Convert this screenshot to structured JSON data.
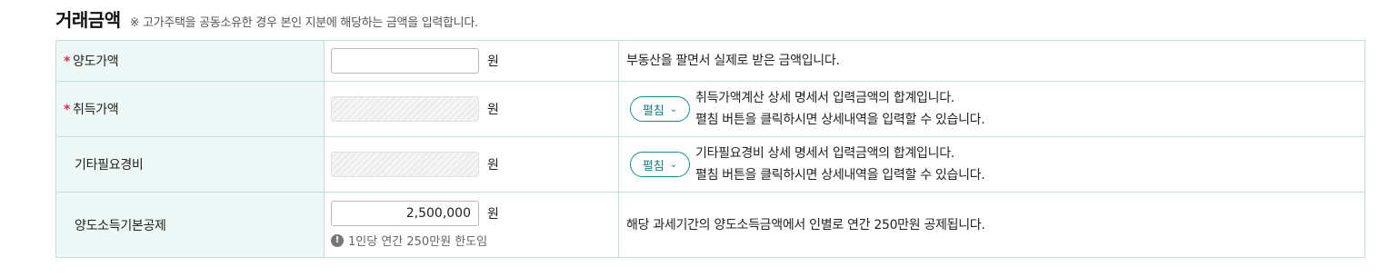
{
  "header": {
    "title": "거래금액",
    "note": "※ 고가주택을 공동소유한 경우 본인 지분에 해당하는 금액을 입력합니다."
  },
  "rows": [
    {
      "required_mark": "*",
      "label": "양도가액",
      "value": "",
      "unit": "원",
      "description": "부동산을 팔면서 실제로 받은 금액입니다."
    },
    {
      "required_mark": "*",
      "label": "취득가액",
      "value": "",
      "unit": "원",
      "toggle_label": "펼침",
      "description_line1": "취득가액계산 상세 명세서 입력금액의 합계입니다.",
      "description_line2": "펼침 버튼을 클릭하시면 상세내역을 입력할 수 있습니다."
    },
    {
      "label": "기타필요경비",
      "value": "",
      "unit": "원",
      "toggle_label": "펼침",
      "description_line1": "기타필요경비 상세 명세서 입력금액의 합계입니다.",
      "description_line2": "펼침 버튼을 클릭하시면 상세내역을 입력할 수 있습니다."
    },
    {
      "label": "양도소득기본공제",
      "value": "2,500,000",
      "unit": "원",
      "hint_icon": "!",
      "hint": "1인당 연간 250만원 한도임",
      "description": "해당 과세기간의 양도소득금액에서 인별로 연간 250만원 공제됩니다."
    }
  ],
  "icons": {
    "toggle_chevron": "chevron-down-icon",
    "hint": "exclamation-circle-icon"
  },
  "colors": {
    "label_bg": "#eef8f7",
    "border": "#c5dede",
    "required": "#e8254a",
    "accent": "#1a8e8e"
  }
}
